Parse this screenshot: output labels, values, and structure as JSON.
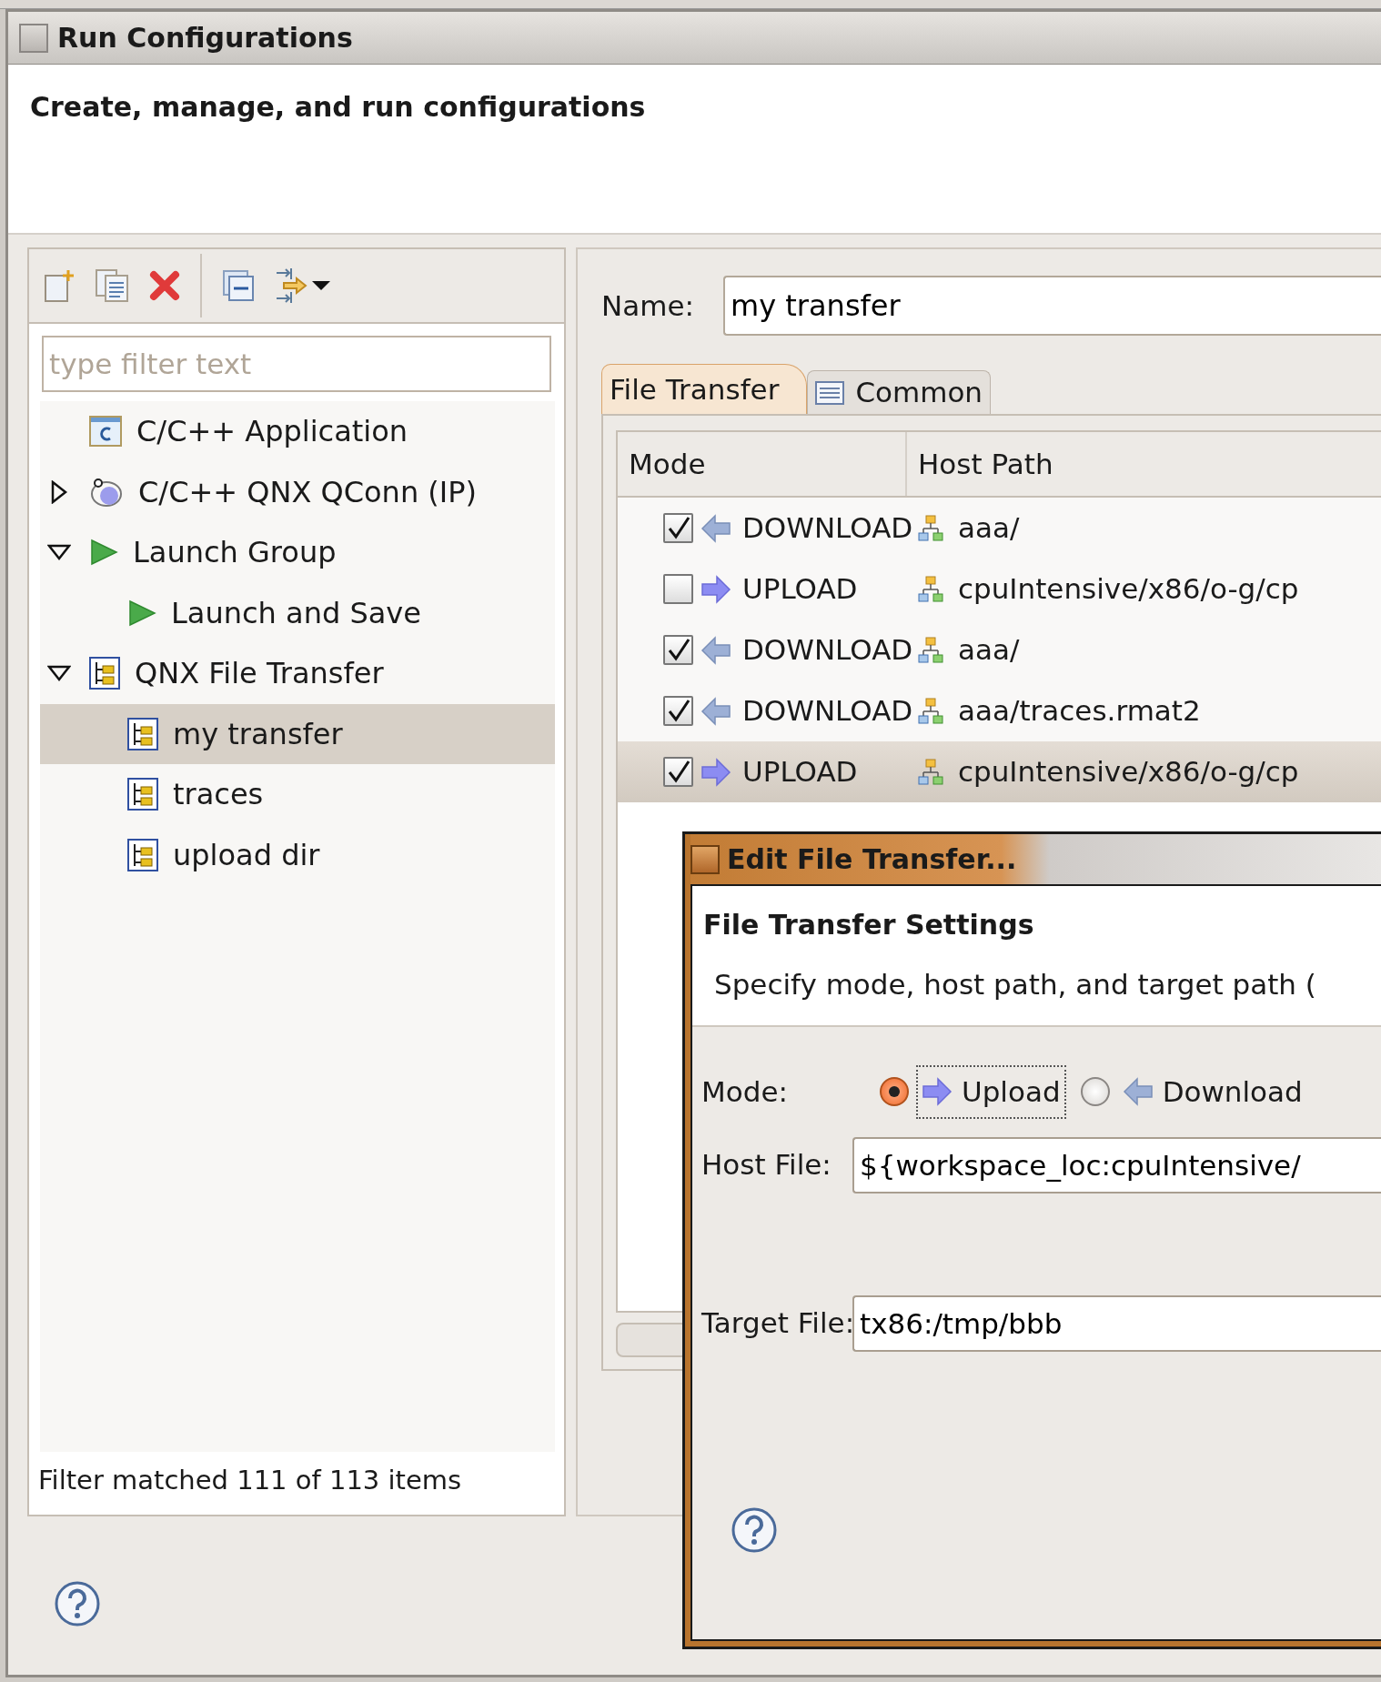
{
  "window": {
    "title": "Run Configurations"
  },
  "header": {
    "message": "Create, manage, and run configurations"
  },
  "toolbar": [
    {
      "kind": "new"
    },
    {
      "kind": "duplicate"
    },
    {
      "kind": "delete"
    },
    {
      "kind": "separator"
    },
    {
      "kind": "collapse"
    },
    {
      "kind": "filter",
      "dropdown": true
    }
  ],
  "filter": {
    "placeholder": "type filter text"
  },
  "tree": [
    {
      "label": "C/C++ Application",
      "kind": "c-app",
      "selected": false
    },
    {
      "label": "C/C++ QNX QConn (IP)",
      "kind": "qconn",
      "expanded": false,
      "selected": false
    },
    {
      "label": "Launch Group",
      "kind": "launch",
      "expanded": true,
      "selected": false,
      "children": [
        {
          "label": "Launch and Save",
          "kind": "launch",
          "selected": false
        }
      ]
    },
    {
      "label": "QNX File Transfer",
      "kind": "transfer",
      "expanded": true,
      "selected": false,
      "children": [
        {
          "label": "my transfer",
          "kind": "transfer",
          "selected": true
        },
        {
          "label": "traces",
          "kind": "transfer",
          "selected": false
        },
        {
          "label": "upload dir",
          "kind": "transfer",
          "selected": false
        }
      ]
    }
  ],
  "filter_status": "Filter matched 111 of 113 items",
  "name": {
    "label": "Name:",
    "value": "my transfer"
  },
  "tabs": [
    {
      "label": "File Transfer",
      "kind": "plain",
      "selected": true
    },
    {
      "label": "Common",
      "kind": "common",
      "selected": false
    }
  ],
  "table": {
    "columns": [
      "Mode",
      "Host Path"
    ],
    "rows": [
      {
        "checked": true,
        "kind": "download",
        "mode": "DOWNLOAD",
        "host_path": "aaa/",
        "selected": false
      },
      {
        "checked": false,
        "kind": "upload",
        "mode": "UPLOAD",
        "host_path": "cpuIntensive/x86/o-g/cp",
        "selected": false
      },
      {
        "checked": true,
        "kind": "download",
        "mode": "DOWNLOAD",
        "host_path": "aaa/",
        "selected": false
      },
      {
        "checked": true,
        "kind": "download",
        "mode": "DOWNLOAD",
        "host_path": "aaa/traces.rmat2",
        "selected": false
      },
      {
        "checked": true,
        "kind": "upload",
        "mode": "UPLOAD",
        "host_path": "cpuIntensive/x86/o-g/cp",
        "selected": true
      }
    ]
  },
  "dialog": {
    "title": "Edit File Transfer...",
    "heading": "File Transfer Settings",
    "description": "Specify mode, host path, and target path (",
    "mode_label": "Mode:",
    "modes": [
      {
        "label": "Upload",
        "kind": "upload",
        "selected": true,
        "focused": true
      },
      {
        "label": "Download",
        "kind": "download",
        "selected": false,
        "focused": false
      }
    ],
    "host_file": {
      "label": "Host File:",
      "value": "${workspace_loc:cpuIntensive/"
    },
    "target_file": {
      "label": "Target File:",
      "value": "tx86:/tmp/bbb"
    }
  }
}
